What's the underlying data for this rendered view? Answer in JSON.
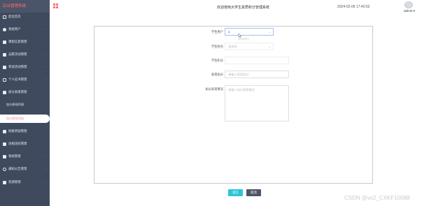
{
  "sidebar": {
    "brand": "后台管理系统",
    "items": [
      {
        "label": "后台首页",
        "icon": "home-icon"
      },
      {
        "label": "系统用户",
        "icon": "user-icon"
      },
      {
        "label": "课程信息管理",
        "icon": "book-icon"
      },
      {
        "label": "志愿活动管理",
        "icon": "heart-icon"
      },
      {
        "label": "参加活动管理",
        "icon": "flag-icon"
      },
      {
        "label": "个人证书管理",
        "icon": "certificate-icon"
      },
      {
        "label": "加分表现管理",
        "icon": "star-icon"
      },
      {
        "label": "校级奖励管理",
        "icon": "trophy-icon"
      },
      {
        "label": "违规违纪管理",
        "icon": "warning-icon"
      },
      {
        "label": "系统管理",
        "icon": "gear-icon"
      },
      {
        "label": "通知公告管理",
        "icon": "bell-icon"
      },
      {
        "label": "资源管理",
        "icon": "folder-icon"
      }
    ],
    "subitems": {
      "list": "加分表现列表",
      "add": "加分表现添加"
    }
  },
  "header": {
    "welcome": "欢迎使用大学生素质积分管理系统",
    "datetime": "2024-02-06 17:40:52",
    "user": "admin ▾"
  },
  "form": {
    "fields": {
      "student_account": {
        "label": "学生用户",
        "value": "1",
        "hint": "请选择学生"
      },
      "student_name": {
        "label": "学生姓名",
        "placeholder": "请选择"
      },
      "student_score": {
        "label": "学生积分",
        "value": ""
      },
      "performance_bonus": {
        "label": "表现加分",
        "placeholder": "请输入表现加分"
      },
      "performance_detail": {
        "label": "加分表现情况",
        "placeholder": "请输入加分表现情况"
      }
    },
    "submit_label": "提交",
    "cancel_label": "取消"
  },
  "watermark": "CSDN @vx2_CXKF10088",
  "colors": {
    "sidebar_bg": "#3f4a5e",
    "brand_text": "#ff6e6e",
    "active_text": "#f08a8a",
    "submit_bg": "#2ec5d6",
    "cancel_bg": "#4d5567"
  }
}
